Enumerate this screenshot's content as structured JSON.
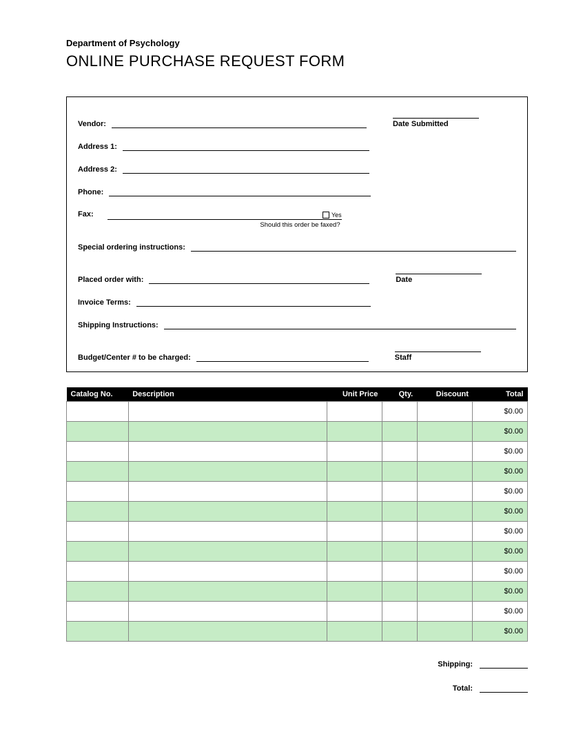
{
  "header": {
    "department": "Department of Psychology",
    "title": "ONLINE PURCHASE REQUEST FORM"
  },
  "form": {
    "vendor_label": "Vendor:",
    "date_submitted_label": "Date Submitted",
    "address1_label": "Address 1:",
    "address2_label": "Address 2:",
    "phone_label": "Phone:",
    "fax_label": "Fax:",
    "fax_checkbox_label": "Yes",
    "fax_question": "Should this order be faxed?",
    "special_label": "Special ordering instructions:",
    "placed_label": "Placed order with:",
    "date_label": "Date",
    "invoice_label": "Invoice Terms:",
    "shipping_inst_label": "Shipping Instructions:",
    "budget_label": "Budget/Center # to be charged:",
    "staff_label": "Staff"
  },
  "table": {
    "headers": {
      "catalog": "Catalog No.",
      "description": "Description",
      "unit_price": "Unit Price",
      "qty": "Qty.",
      "discount": "Discount",
      "total": "Total"
    },
    "rows": [
      {
        "catalog": "",
        "description": "",
        "unit_price": "",
        "qty": "",
        "discount": "",
        "total": "$0.00"
      },
      {
        "catalog": "",
        "description": "",
        "unit_price": "",
        "qty": "",
        "discount": "",
        "total": "$0.00"
      },
      {
        "catalog": "",
        "description": "",
        "unit_price": "",
        "qty": "",
        "discount": "",
        "total": "$0.00"
      },
      {
        "catalog": "",
        "description": "",
        "unit_price": "",
        "qty": "",
        "discount": "",
        "total": "$0.00"
      },
      {
        "catalog": "",
        "description": "",
        "unit_price": "",
        "qty": "",
        "discount": "",
        "total": "$0.00"
      },
      {
        "catalog": "",
        "description": "",
        "unit_price": "",
        "qty": "",
        "discount": "",
        "total": "$0.00"
      },
      {
        "catalog": "",
        "description": "",
        "unit_price": "",
        "qty": "",
        "discount": "",
        "total": "$0.00"
      },
      {
        "catalog": "",
        "description": "",
        "unit_price": "",
        "qty": "",
        "discount": "",
        "total": "$0.00"
      },
      {
        "catalog": "",
        "description": "",
        "unit_price": "",
        "qty": "",
        "discount": "",
        "total": "$0.00"
      },
      {
        "catalog": "",
        "description": "",
        "unit_price": "",
        "qty": "",
        "discount": "",
        "total": "$0.00"
      },
      {
        "catalog": "",
        "description": "",
        "unit_price": "",
        "qty": "",
        "discount": "",
        "total": "$0.00"
      },
      {
        "catalog": "",
        "description": "",
        "unit_price": "",
        "qty": "",
        "discount": "",
        "total": "$0.00"
      }
    ]
  },
  "totals": {
    "shipping_label": "Shipping:",
    "shipping_value": "",
    "total_label": "Total:",
    "total_value": ""
  }
}
